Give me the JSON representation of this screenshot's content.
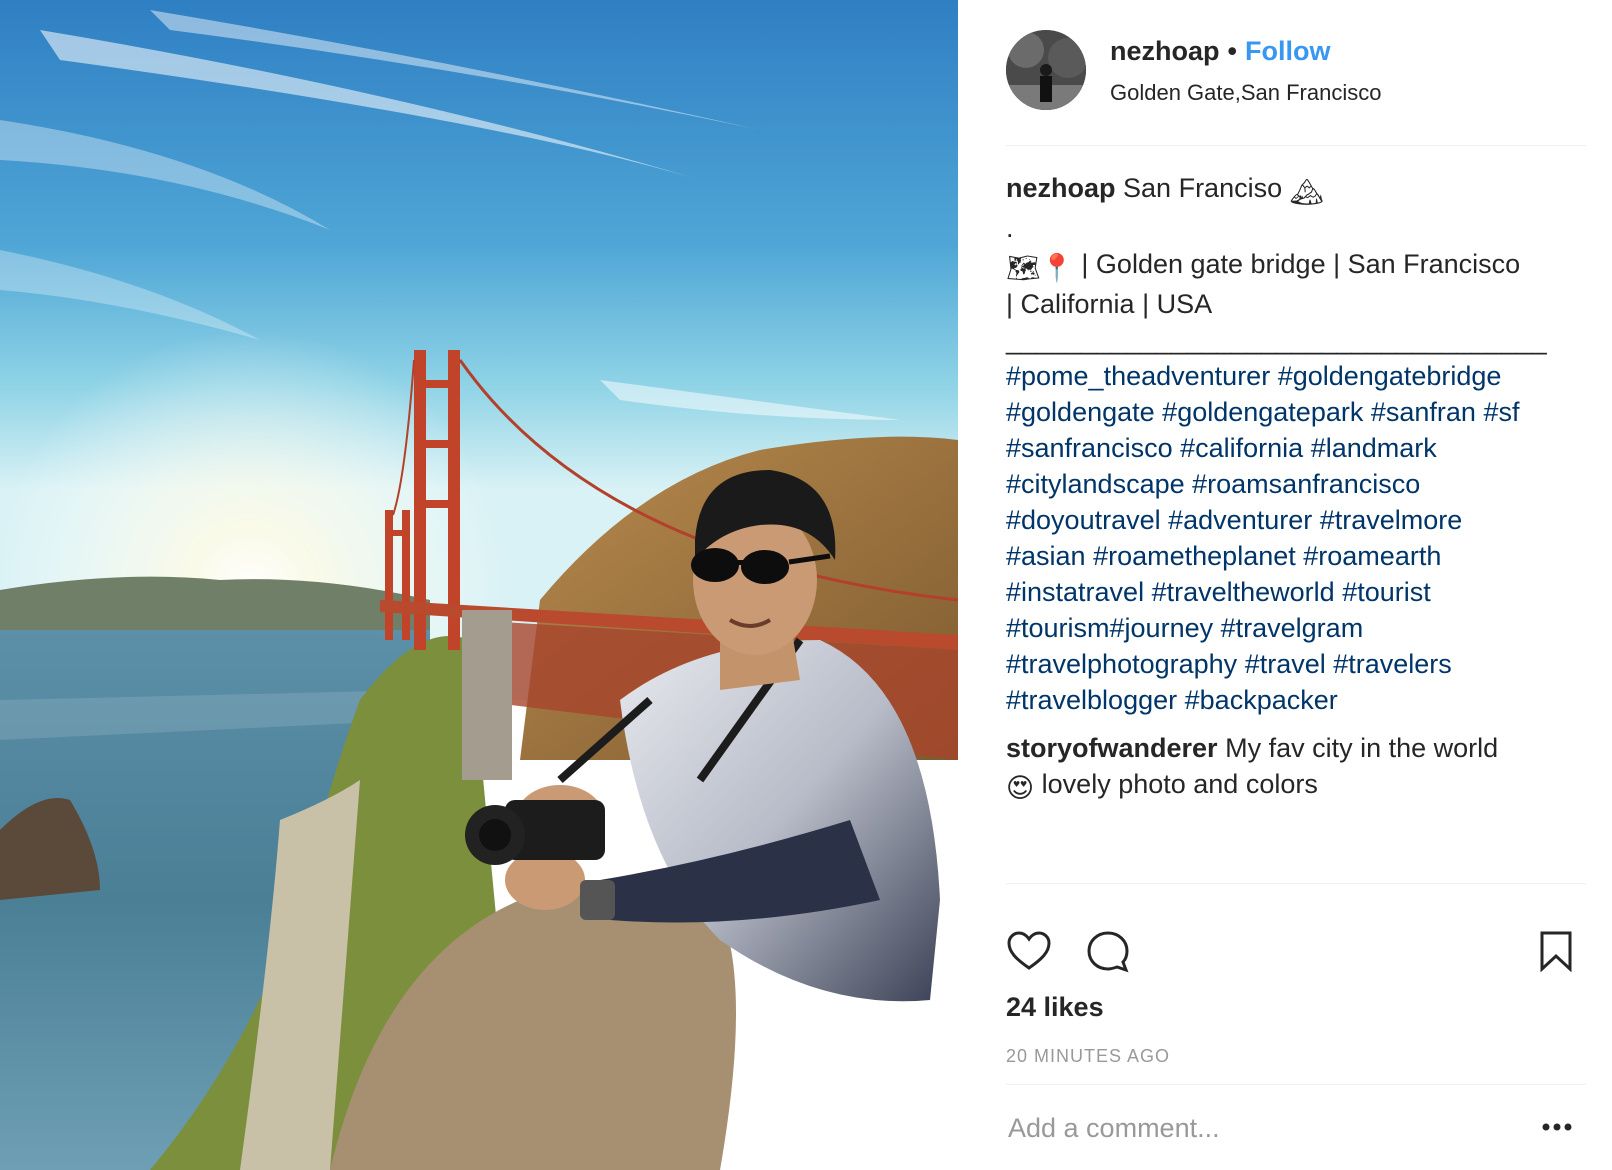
{
  "post": {
    "username": "nezhoap",
    "separator": "•",
    "follow_label": "Follow",
    "location": "Golden Gate,San Francisco"
  },
  "caption": {
    "username": "nezhoap",
    "text": "San Franciso",
    "mountain_emoji": "🏔",
    "dot_line": ".",
    "place_emojis": "🗺📍",
    "place_line_1": " | Golden gate bridge | San Francisco",
    "place_line_2": "| California | USA",
    "underscore_line": "____________________________________"
  },
  "hashtags": {
    "line1": [
      "#pome_theadventurer",
      "#goldengatebridge"
    ],
    "line2": [
      "#goldengate",
      "#goldengatepark",
      "#sanfran",
      "#sf"
    ],
    "line3": [
      "#sanfrancisco",
      "#california",
      "#landmark"
    ],
    "line4": [
      "#citylandscape",
      "#roamsanfrancisco"
    ],
    "line5": [
      "#doyoutravel",
      "#adventurer",
      "#travelmore"
    ],
    "line6": [
      "#asian",
      "#roametheplanet",
      "#roamearth"
    ],
    "line7": [
      "#instatravel",
      "#traveltheworld",
      "#tourist"
    ],
    "line8": [
      "#tourism#journey",
      "#travelgram"
    ],
    "line9": [
      "#travelphotography",
      "#travel",
      "#travelers"
    ],
    "line10": [
      "#travelblogger",
      "#backpacker"
    ]
  },
  "comment": {
    "username": "storyofwanderer",
    "text_line_1": "My fav city in the world",
    "emoji": "😍",
    "text_line_2": "lovely photo and colors"
  },
  "actions": {
    "like_icon": "heart-outline-icon",
    "comment_icon": "speech-bubble-icon",
    "save_icon": "bookmark-outline-icon",
    "more_icon": "ellipsis-icon"
  },
  "likes": "24 likes",
  "timestamp": "20 MINUTES AGO",
  "add_comment_placeholder": "Add a comment...",
  "colors": {
    "follow": "#3897f0",
    "hashtag": "#003569",
    "text": "#262626",
    "muted": "#999999",
    "divider": "#efefef"
  }
}
